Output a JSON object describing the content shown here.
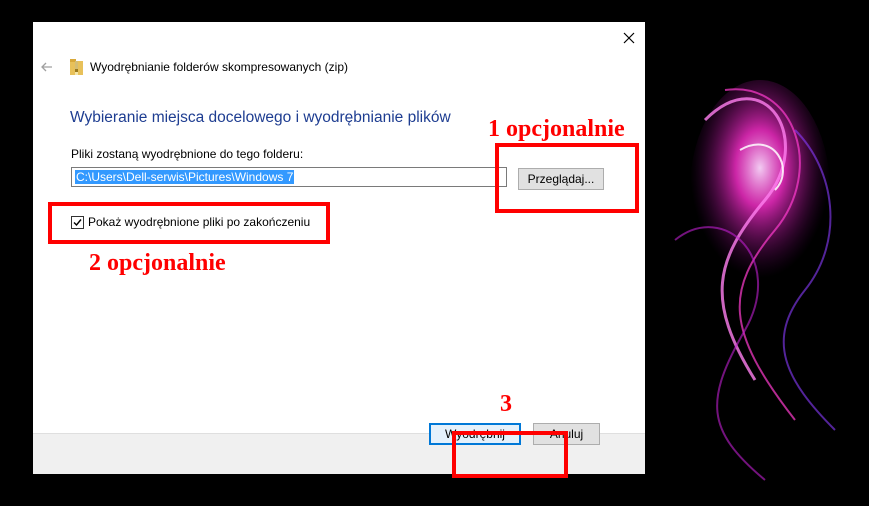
{
  "dialog": {
    "title": "Wyodrębnianie folderów skompresowanych (zip)",
    "heading": "Wybieranie miejsca docelowego i wyodrębnianie plików",
    "folder_label": "Pliki zostaną wyodrębnione do tego folderu:",
    "path_value": "C:\\Users\\Dell-serwis\\Pictures\\Windows 7",
    "browse_label": "Przeglądaj...",
    "checkbox_label": "Pokaż wyodrębnione pliki po zakończeniu",
    "checkbox_checked": true,
    "extract_label": "Wyodrębnij",
    "cancel_label": "Anuluj"
  },
  "annotations": {
    "label_1": "1 opcjonalnie",
    "label_2": "2 opcjonalnie",
    "label_3": "3",
    "color": "#ff0000"
  },
  "icons": {
    "close": "close-icon",
    "back": "back-arrow-icon",
    "zip": "zip-folder-icon",
    "checkmark": "checkmark-icon"
  },
  "colors": {
    "heading": "#1e3d91",
    "selection": "#3399ff",
    "accent_border": "#0078d7",
    "footer": "#f0f0f0"
  }
}
